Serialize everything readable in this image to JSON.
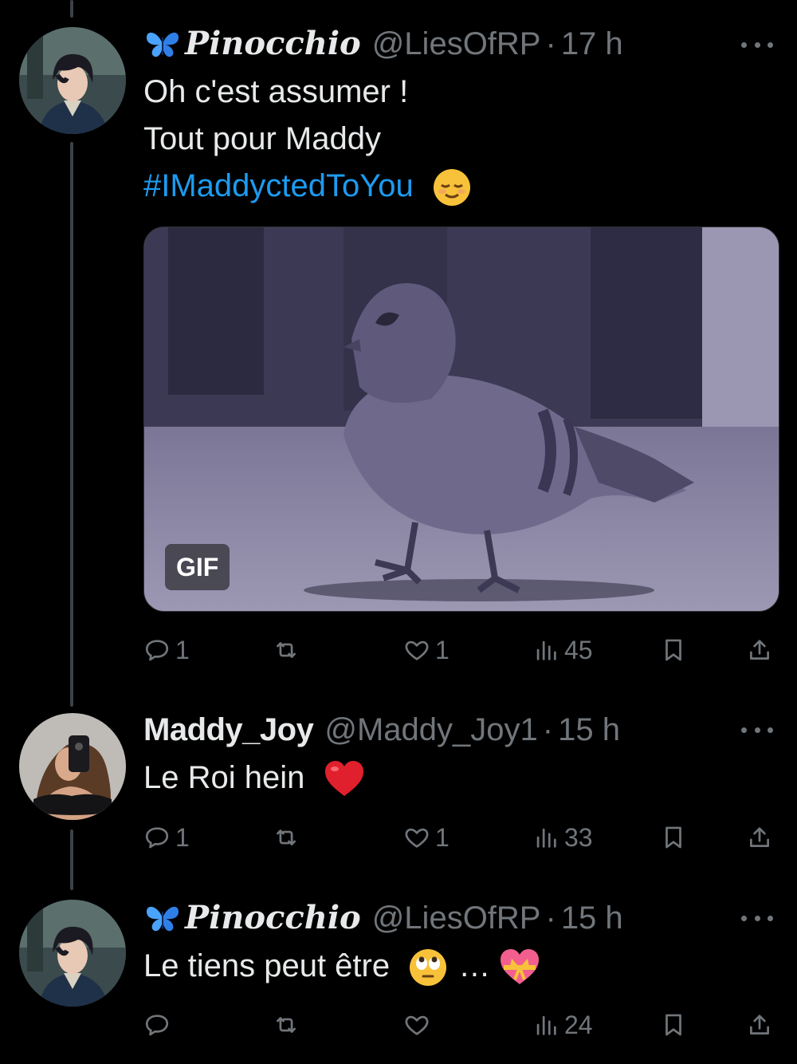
{
  "tweets": [
    {
      "name": "Pinocchio",
      "handle": "@LiesOfRP",
      "separator": "·",
      "time": "17 h",
      "lines": [
        "Oh c'est assumer !",
        "Tout pour Maddy"
      ],
      "hashtag": "#IMaddyctedToYou",
      "emoji": "relieved-face",
      "media": {
        "badge": "GIF",
        "subject": "pigeon-walking"
      },
      "actions": {
        "replies": "1",
        "retweets": "",
        "likes": "1",
        "views": "45"
      }
    },
    {
      "name": "Maddy_Joy",
      "handle": "@Maddy_Joy1",
      "separator": "·",
      "time": "15 h",
      "lines": [
        "Le Roi hein"
      ],
      "emoji": "red-heart",
      "actions": {
        "replies": "1",
        "retweets": "",
        "likes": "1",
        "views": "33"
      }
    },
    {
      "name": "Pinocchio",
      "handle": "@LiesOfRP",
      "separator": "·",
      "time": "15 h",
      "lines": [
        "Le tiens peut être"
      ],
      "ellipsis": "…",
      "emoji": "rolling-eyes-face",
      "emoji2": "heart-with-ribbon",
      "actions": {
        "replies": "",
        "retweets": "",
        "likes": "",
        "views": "24"
      }
    }
  ],
  "colors": {
    "background": "#000000",
    "text": "#e7e9ea",
    "muted": "#71767b",
    "link": "#1d9bf0",
    "thread_line": "#3e4144"
  },
  "icons": [
    "butterfly-icon",
    "reply-icon",
    "retweet-icon",
    "like-icon",
    "views-icon",
    "bookmark-icon",
    "share-icon",
    "more-icon"
  ]
}
